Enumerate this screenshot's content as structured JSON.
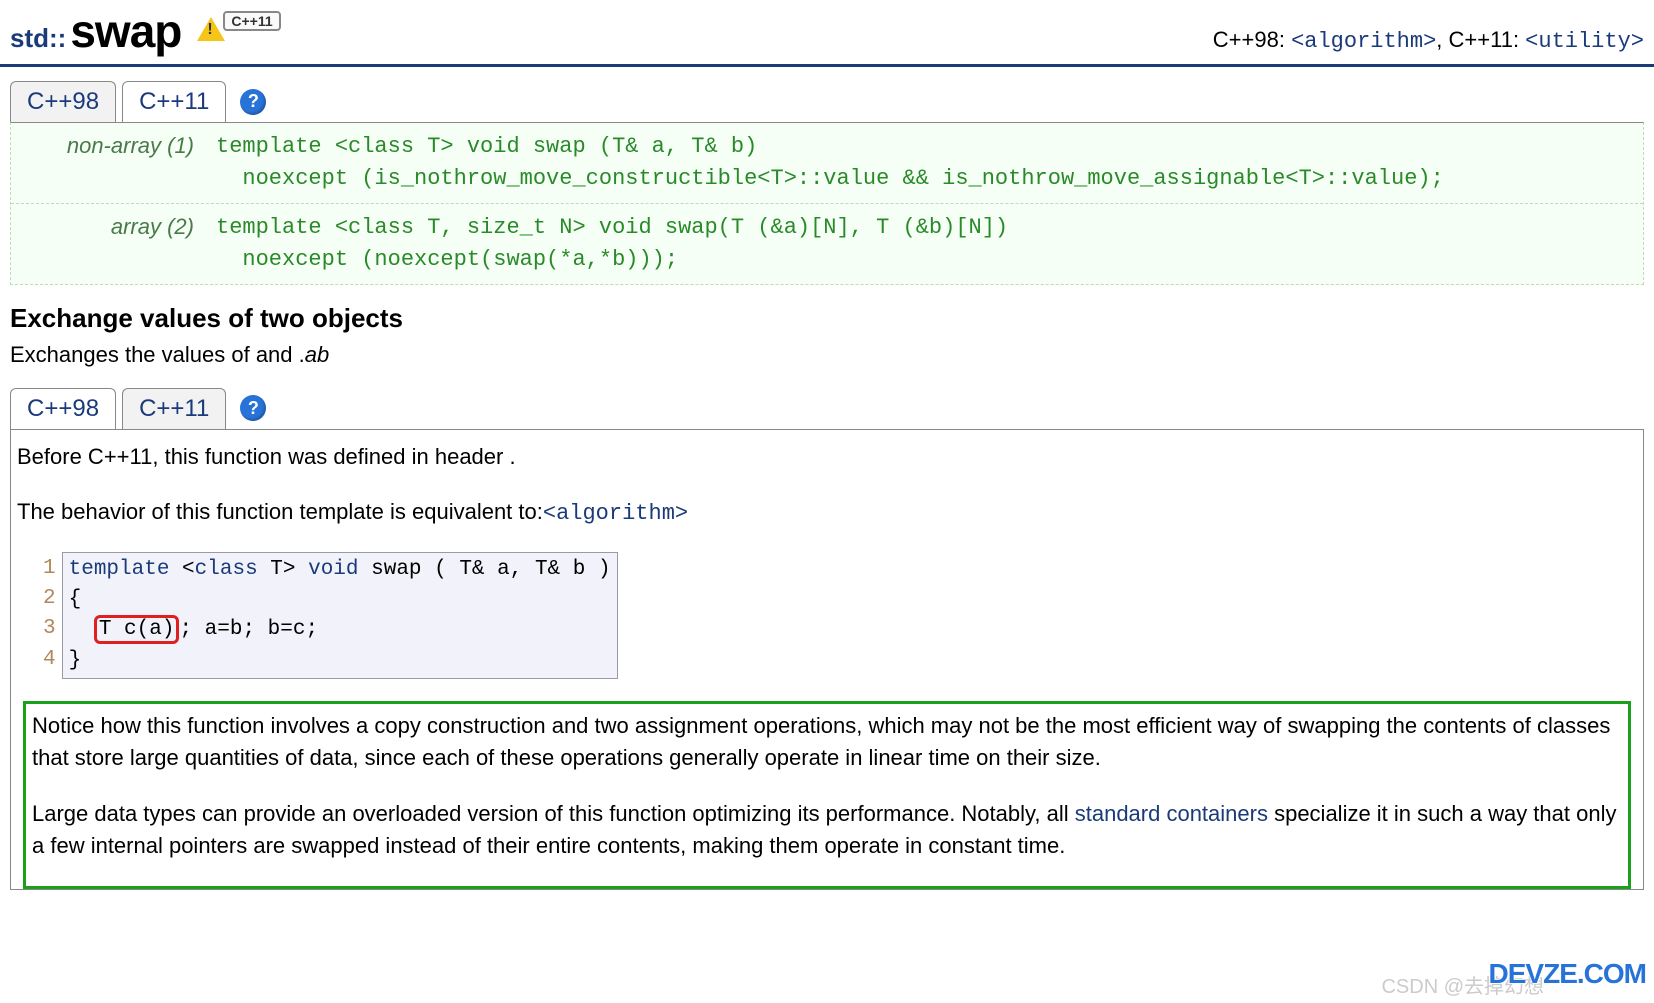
{
  "header": {
    "namespace": "std::",
    "name": "swap",
    "cpp_badge": "C++11",
    "right_label_prefix": "C++98: ",
    "right_h1": "<algorithm>",
    "right_mid": ", C++11: ",
    "right_h2": "<utility>"
  },
  "tabs1": {
    "t1": "C++98",
    "t2": "C++11",
    "help": "?"
  },
  "sigs": {
    "row1_label": "non-array (1)",
    "row1_code": "template <class T> void swap (T& a, T& b)\n  noexcept (is_nothrow_move_constructible<T>::value && is_nothrow_move_assignable<T>::value);",
    "row2_label": "array (2)",
    "row2_code": "template <class T, size_t N> void swap(T (&a)[N], T (&b)[N])\n  noexcept (noexcept(swap(*a,*b)));"
  },
  "section": {
    "title": "Exchange values of two objects",
    "desc_prefix": "Exchanges the values of and .",
    "desc_ital": "ab"
  },
  "tabs2": {
    "t1": "C++98",
    "t2": "C++11",
    "help": "?"
  },
  "panel": {
    "p1": "Before C++11, this function was defined in header .",
    "p2a": "The behavior of this function template is equivalent to:",
    "p2mono": "<algorithm>"
  },
  "code": {
    "linenos": "1\n2\n3\n4",
    "l1_kw1": "template",
    "l1_txt1": " <",
    "l1_kw2": "class",
    "l1_txt2": " T> ",
    "l1_kw3": "void",
    "l1_txt3": " swap ( T& a, T& b )",
    "l2": "{",
    "l3_box": "T c(a)",
    "l3_rest": "; a=b; b=c;",
    "l4": "}"
  },
  "notice": {
    "p1": "Notice how this function involves a copy construction and two assignment operations, which may not be the most efficient way of swapping the contents of classes that store large quantities of data, since each of these operations generally operate in linear time on their size.",
    "p2a": "Large data types can provide an overloaded version of this function optimizing its performance. Notably, all ",
    "p2link": "standard containers",
    "p2b": " specialize it in such a way that only a few internal pointers are swapped instead of their entire contents, making them operate in constant time."
  },
  "watermarks": {
    "w1": "CSDN @去掉幻想",
    "w2": "DEVZE.COM"
  }
}
